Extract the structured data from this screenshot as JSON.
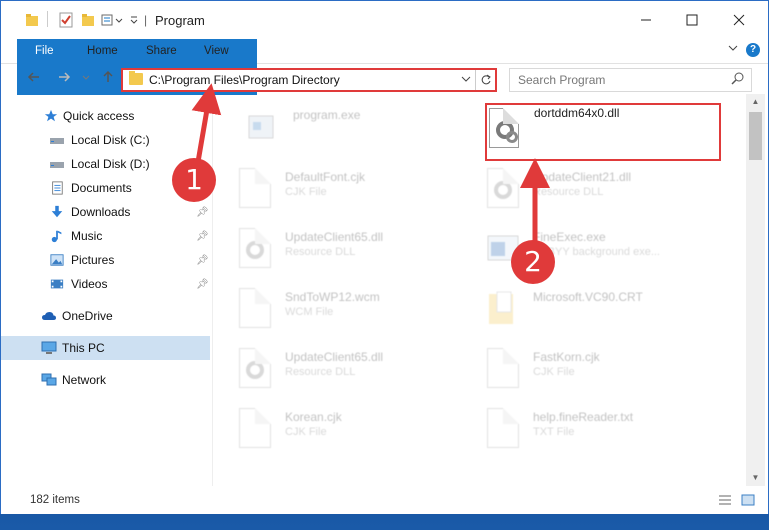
{
  "window": {
    "title": "Program"
  },
  "ribbon": {
    "tabs": [
      "File",
      "Home",
      "Share",
      "View"
    ]
  },
  "nav": {
    "address": "C:\\Program Files\\Program Directory",
    "search_placeholder": "Search Program"
  },
  "sidebar": {
    "items": [
      {
        "label": "Quick access",
        "icon": "star-icon",
        "pinned": false
      },
      {
        "label": "Local Disk (C:)",
        "icon": "drive-icon",
        "pinned": false
      },
      {
        "label": "Local Disk (D:)",
        "icon": "drive-icon",
        "pinned": false
      },
      {
        "label": "Documents",
        "icon": "documents-icon",
        "pinned": false
      },
      {
        "label": "Downloads",
        "icon": "download-arrow-icon",
        "pinned": true
      },
      {
        "label": "Music",
        "icon": "music-note-icon",
        "pinned": true
      },
      {
        "label": "Pictures",
        "icon": "pictures-icon",
        "pinned": true
      },
      {
        "label": "Videos",
        "icon": "videos-icon",
        "pinned": true
      },
      {
        "label": "OneDrive",
        "icon": "cloud-icon",
        "pinned": false
      },
      {
        "label": "This PC",
        "icon": "monitor-icon",
        "pinned": false,
        "selected": true
      },
      {
        "label": "Network",
        "icon": "network-icon",
        "pinned": false
      }
    ]
  },
  "files": [
    {
      "name": "program.exe",
      "type": ""
    },
    {
      "name": "dortddm64x0.dll",
      "type": ""
    },
    {
      "name": "DefaultFont.cjk",
      "type": "CJK File"
    },
    {
      "name": "UpdateClient21.dll",
      "type": "Resource DLL"
    },
    {
      "name": "UpdateClient65.dll",
      "type": "Resource DLL"
    },
    {
      "name": "FineExec.exe",
      "type": "ABBYY background exe..."
    },
    {
      "name": "SndToWP12.wcm",
      "type": "WCM File"
    },
    {
      "name": "Microsoft.VC90.CRT",
      "type": ""
    },
    {
      "name": "UpdateClient65.dll",
      "type": "Resource DLL"
    },
    {
      "name": "FastKorn.cjk",
      "type": "CJK File"
    },
    {
      "name": "Korean.cjk",
      "type": "CJK File"
    },
    {
      "name": "help.fineReader.txt",
      "type": "TXT File"
    }
  ],
  "status": {
    "item_count": "182 items"
  },
  "annotations": {
    "badge1": "1",
    "badge2": "2"
  },
  "colors": {
    "accent": "#1979ca",
    "highlight": "#e03a3a",
    "selected": "#cde0f2"
  }
}
